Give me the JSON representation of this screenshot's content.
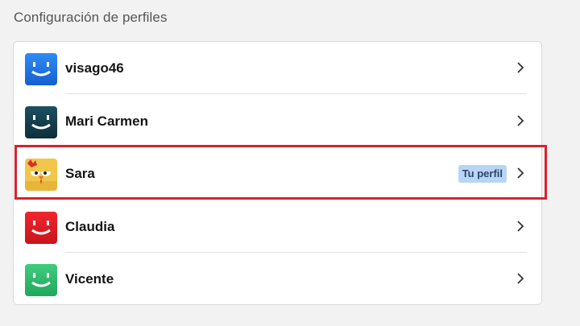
{
  "section": {
    "title": "Configuración de perfiles"
  },
  "colors": {
    "highlight": "#d6222f",
    "badge_bg": "#b9d5f5"
  },
  "profiles": [
    {
      "name": "visago46",
      "avatar": "blue-smile-avatar",
      "color": "#1e6fe0"
    },
    {
      "name": "Mari Carmen",
      "avatar": "dark-teal-smile-avatar",
      "color": "#15404f"
    },
    {
      "name": "Sara",
      "avatar": "yellow-chicken-avatar",
      "color": "#f1c64a",
      "badge": "Tu perfil",
      "highlighted": true
    },
    {
      "name": "Claudia",
      "avatar": "red-smile-avatar",
      "color": "#e01a22"
    },
    {
      "name": "Vicente",
      "avatar": "green-smile-avatar",
      "color": "#2dbb6d"
    }
  ]
}
